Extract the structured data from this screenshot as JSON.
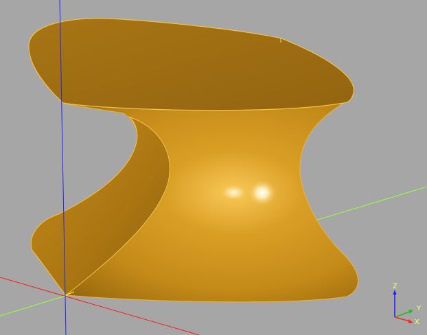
{
  "viewer": {
    "background": "#a6a6a6",
    "model_color": "#d49a22",
    "model_edge_color": "#f0c14a",
    "world_axes": {
      "x_color": "#ff1a1a",
      "y_color": "#9bff3a",
      "z_color": "#2323ff"
    }
  },
  "axes_gizmo": {
    "z_label": "Z",
    "y_label": "Y",
    "x_label": "X",
    "z_color": "#1a1aff",
    "y_color": "#22bb22",
    "x_color": "#ff2020",
    "label_color": "#ffff66"
  }
}
